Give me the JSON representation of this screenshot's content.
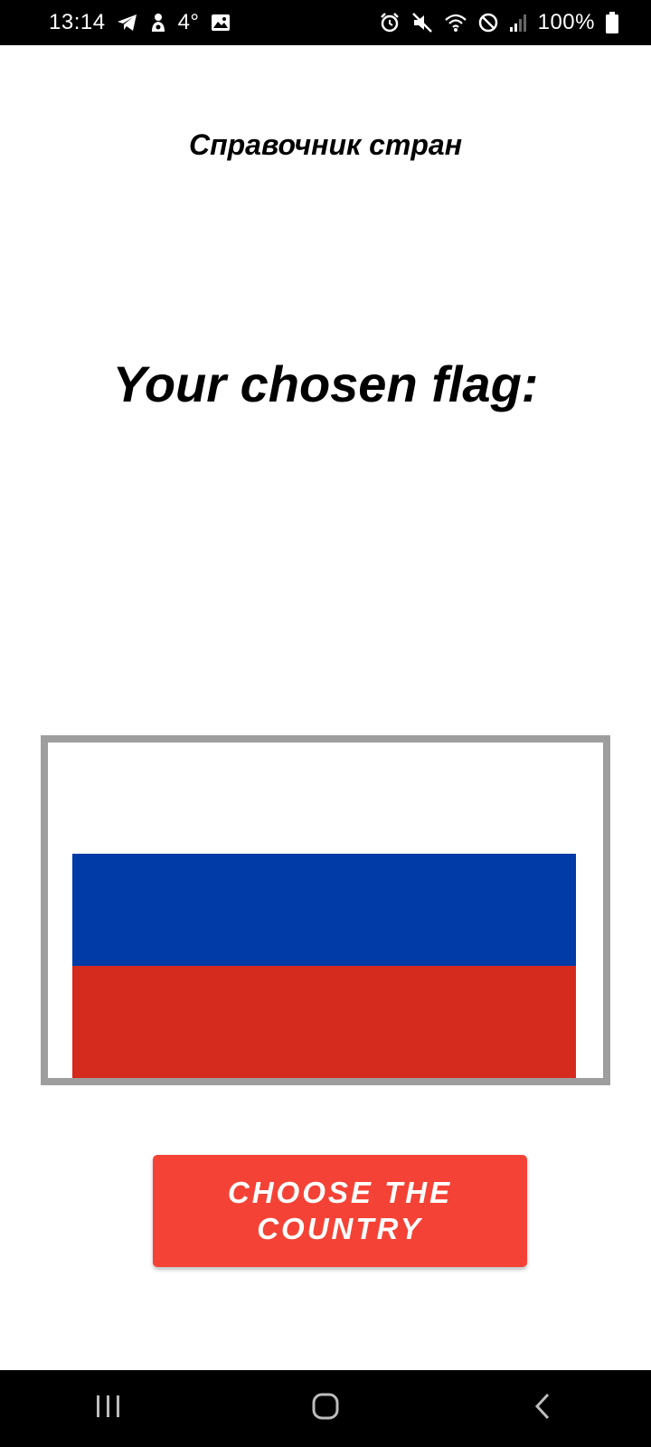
{
  "status_bar": {
    "time": "13:14",
    "temperature": "4°",
    "battery": "100%",
    "icons_left": [
      "telegram-icon",
      "notification-icon",
      "image-icon"
    ],
    "icons_right": [
      "alarm-icon",
      "mute-icon",
      "wifi-icon",
      "do-not-disturb-icon",
      "signal-icon",
      "battery-icon"
    ]
  },
  "app": {
    "title": "Справочник стран",
    "heading": "Your chosen flag:",
    "flag": {
      "country_colors": [
        "#ffffff",
        "#003ba8",
        "#d52b1e"
      ]
    },
    "choose_button_label": "CHOOSE THE COUNTRY",
    "accent_color": "#f44336"
  },
  "nav_bar": {
    "buttons": [
      "recents-icon",
      "home-icon",
      "back-icon"
    ]
  }
}
